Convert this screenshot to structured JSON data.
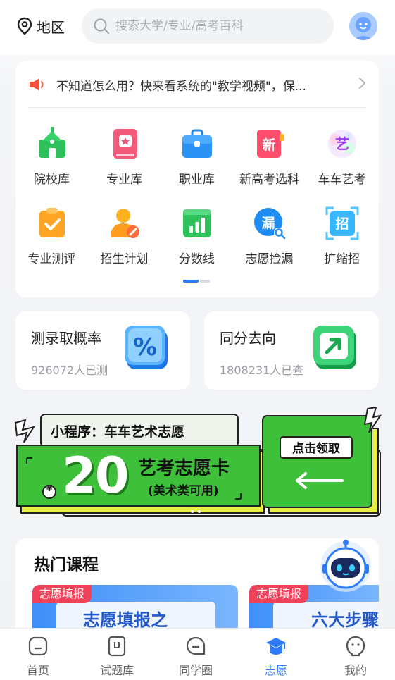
{
  "header": {
    "region_label": "地区",
    "search_placeholder": "搜索大学/专业/高考百科"
  },
  "notice": {
    "text": "不知道怎么用？快来看系统的\"教学视频\"，保..."
  },
  "grid": {
    "items": [
      {
        "label": "院校库",
        "icon": "school-icon"
      },
      {
        "label": "专业库",
        "icon": "major-book-icon"
      },
      {
        "label": "职业库",
        "icon": "briefcase-icon"
      },
      {
        "label": "新高考选科",
        "icon": "new-exam-icon"
      },
      {
        "label": "车车艺考",
        "icon": "art-exam-icon"
      },
      {
        "label": "专业测评",
        "icon": "clipboard-check-icon"
      },
      {
        "label": "招生计划",
        "icon": "enroll-plan-icon"
      },
      {
        "label": "分数线",
        "icon": "score-chart-icon"
      },
      {
        "label": "志愿捡漏",
        "icon": "leak-search-icon"
      },
      {
        "label": "扩缩招",
        "icon": "expand-enroll-icon"
      }
    ],
    "page_indicator": {
      "current": 1,
      "total": 2
    }
  },
  "features": [
    {
      "title": "测录取概率",
      "sub": "926072人已测",
      "icon": "percent-icon"
    },
    {
      "title": "同分去向",
      "sub": "1808231人已查",
      "icon": "arrow-box-icon"
    }
  ],
  "banner": {
    "mini_program": "小程序：车车艺术志愿",
    "amount_symbol": "¥",
    "amount": "20",
    "card_title": "艺考志愿卡",
    "card_sub": "(美术类可用)",
    "cta": "点击领取"
  },
  "courses": {
    "title": "热门课程",
    "items": [
      {
        "tag": "志愿填报",
        "title": "志愿填报之"
      },
      {
        "tag": "志愿填报",
        "title": "六大步骤"
      }
    ]
  },
  "tabs": [
    {
      "label": "首页",
      "icon": "home-icon"
    },
    {
      "label": "试题库",
      "icon": "question-bank-icon"
    },
    {
      "label": "同学圈",
      "icon": "classmates-icon"
    },
    {
      "label": "志愿",
      "icon": "graduation-cap-icon",
      "active": true
    },
    {
      "label": "我的",
      "icon": "profile-icon"
    }
  ],
  "colors": {
    "accent": "#2f7cf6",
    "banner_green": "#3fc03a",
    "tag_red": "#f0435a"
  }
}
